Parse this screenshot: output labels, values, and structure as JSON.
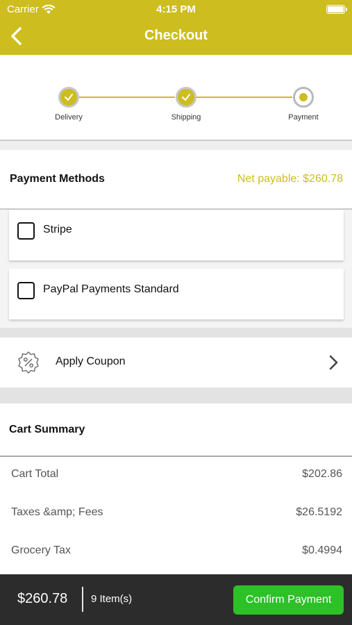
{
  "status_bar": {
    "carrier": "Carrier",
    "time": "4:15 PM"
  },
  "nav": {
    "title": "Checkout",
    "back_icon": "chevron-left-icon"
  },
  "stepper": {
    "steps": [
      {
        "label": "Delivery",
        "state": "done"
      },
      {
        "label": "Shipping",
        "state": "done"
      },
      {
        "label": "Payment",
        "state": "current"
      }
    ]
  },
  "payment_methods": {
    "title": "Payment Methods",
    "net_payable": "Net payable: $260.78",
    "methods": [
      {
        "label": "Stripe",
        "checked": false
      },
      {
        "label": "PayPal Payments Standard",
        "checked": false
      }
    ]
  },
  "coupon": {
    "label": "Apply Coupon",
    "icon": "coupon-percent-icon"
  },
  "cart_summary": {
    "title": "Cart Summary",
    "rows": [
      {
        "label": "Cart Total",
        "value": "$202.86"
      },
      {
        "label": "Taxes &amp; Fees",
        "value": "$26.5192"
      },
      {
        "label": "Grocery Tax",
        "value": "$0.4994"
      }
    ]
  },
  "bottom_bar": {
    "total": "$260.78",
    "items": "9 Item(s)",
    "confirm_label": "Confirm Payment"
  },
  "colors": {
    "accent": "#cdbd1e",
    "confirm": "#2cc127",
    "bottom_bar": "#2c2c2c"
  }
}
